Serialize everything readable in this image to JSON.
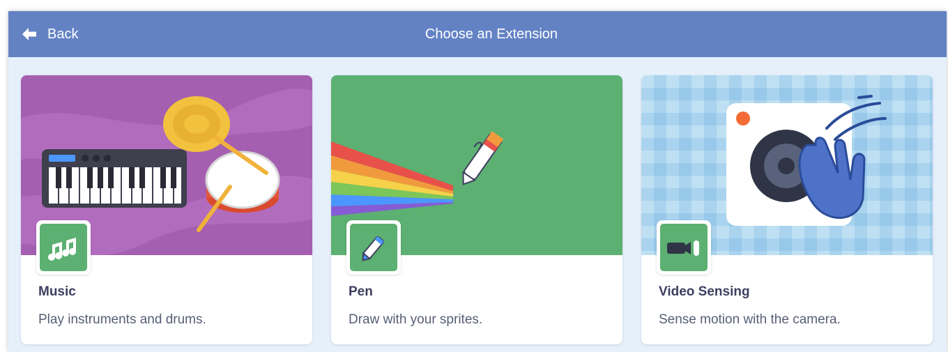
{
  "header": {
    "back_label": "Back",
    "title": "Choose an Extension"
  },
  "extensions": [
    {
      "name": "Music",
      "description": "Play instruments and drums.",
      "icon": "music-notes-icon"
    },
    {
      "name": "Pen",
      "description": "Draw with your sprites.",
      "icon": "pen-icon"
    },
    {
      "name": "Video Sensing",
      "description": "Sense motion with the camera.",
      "icon": "video-camera-icon"
    }
  ],
  "colors": {
    "header": "#6382c4",
    "icon_background": "#5cb071",
    "music_image_bg": "#a55fb0",
    "pen_image_bg": "#5cb071",
    "video_image_bg": "#a9d3ee",
    "title_text": "#3e3e60",
    "description_text": "#575e75"
  }
}
